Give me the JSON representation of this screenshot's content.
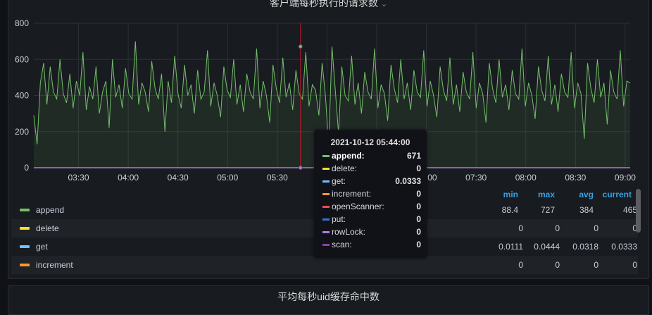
{
  "panel": {
    "title": "客户端每秒执行的请求数"
  },
  "panel2": {
    "title": "平均每秒uid缓存命中数"
  },
  "chart_data": {
    "type": "line",
    "title": "客户端每秒执行的请求数",
    "ylim": [
      0,
      800
    ],
    "y_ticks": [
      "0",
      "200",
      "400",
      "600",
      "800"
    ],
    "x_ticks": [
      "03:30",
      "04:00",
      "04:30",
      "05:00",
      "05:30",
      "06:00",
      "06:30",
      "07:00",
      "07:30",
      "08:00",
      "08:30",
      "09:00"
    ],
    "x_range_minutes": [
      183,
      543
    ],
    "grid": true,
    "hover_time_minutes": 344,
    "series": [
      {
        "name": "append",
        "color": "#73bf69",
        "values": [
          290,
          130,
          470,
          580,
          350,
          560,
          420,
          380,
          600,
          410,
          360,
          520,
          330,
          480,
          400,
          640,
          320,
          450,
          380,
          560,
          300,
          420,
          480,
          220,
          600,
          390,
          460,
          330,
          550,
          410,
          380,
          700,
          350,
          470,
          420,
          310,
          590,
          440,
          380,
          520,
          200,
          480,
          360,
          620,
          410,
          330,
          570,
          400,
          460,
          300,
          540,
          380,
          420,
          650,
          340,
          470,
          400,
          280,
          560,
          430,
          390,
          600,
          350,
          460,
          310,
          520,
          420,
          380,
          660,
          330,
          480,
          400,
          250,
          570,
          440,
          360,
          610,
          390,
          470,
          320,
          540,
          410,
          380,
          640,
          340,
          460,
          430,
          290,
          580,
          400,
          120,
          671,
          430,
          190,
          560,
          400,
          370,
          620,
          350,
          470,
          300,
          530,
          420,
          380,
          660,
          330,
          460,
          410,
          260,
          570,
          440,
          360,
          600,
          380,
          470,
          320,
          540,
          420,
          390,
          650,
          340,
          480,
          400,
          280,
          560,
          430,
          370,
          610,
          350,
          460,
          310,
          530,
          420,
          380,
          640,
          330,
          470,
          410,
          250,
          580,
          440,
          360,
          600,
          390,
          460,
          320,
          540,
          410,
          380,
          660,
          340,
          470,
          400,
          270,
          560,
          430,
          370,
          620,
          350,
          460,
          310,
          520,
          420,
          390,
          640,
          330,
          470,
          410,
          160,
          580,
          440,
          360,
          600,
          390,
          470,
          240,
          540,
          420,
          380,
          650,
          340,
          480,
          470
        ]
      },
      {
        "name": "delete",
        "color": "#fade2a",
        "values": [
          0,
          0
        ]
      },
      {
        "name": "get",
        "color": "#5794f2",
        "values": [
          0.0333,
          0.0333
        ]
      },
      {
        "name": "increment",
        "color": "#ff9830",
        "values": [
          0,
          0
        ]
      },
      {
        "name": "openScanner",
        "color": "#f2495c",
        "values": [
          0,
          0
        ]
      },
      {
        "name": "put",
        "color": "#3274d9",
        "values": [
          0,
          0
        ]
      },
      {
        "name": "rowLock",
        "color": "#b877d9",
        "values": [
          0,
          0
        ]
      },
      {
        "name": "scan",
        "color": "#8f3bb8",
        "values": [
          0,
          0
        ]
      }
    ]
  },
  "legend": {
    "headers": {
      "min": "min",
      "max": "max",
      "avg": "avg",
      "current": "current"
    },
    "rows": [
      {
        "name": "append",
        "color": "#73bf69",
        "min": "88.4",
        "max": "727",
        "avg": "384",
        "current": "465"
      },
      {
        "name": "delete",
        "color": "#fade2a",
        "min": "0",
        "max": "0",
        "avg": "0",
        "current": "0"
      },
      {
        "name": "get",
        "color": "#73bfff",
        "min": "0.0111",
        "max": "0.0444",
        "avg": "0.0318",
        "current": "0.0333"
      },
      {
        "name": "increment",
        "color": "#ff9830",
        "min": "0",
        "max": "0",
        "avg": "0",
        "current": "0"
      }
    ]
  },
  "tooltip": {
    "time": "2021-10-12 05:44:00",
    "rows": [
      {
        "name": "append:",
        "color": "#73bf69",
        "value": "671"
      },
      {
        "name": "delete:",
        "color": "#fade2a",
        "value": "0"
      },
      {
        "name": "get:",
        "color": "#73bfff",
        "value": "0.0333"
      },
      {
        "name": "increment:",
        "color": "#ff9830",
        "value": "0"
      },
      {
        "name": "openScanner:",
        "color": "#f2495c",
        "value": "0"
      },
      {
        "name": "put:",
        "color": "#3274d9",
        "value": "0"
      },
      {
        "name": "rowLock:",
        "color": "#b877d9",
        "value": "0"
      },
      {
        "name": "scan:",
        "color": "#8f3bb8",
        "value": "0"
      }
    ]
  }
}
